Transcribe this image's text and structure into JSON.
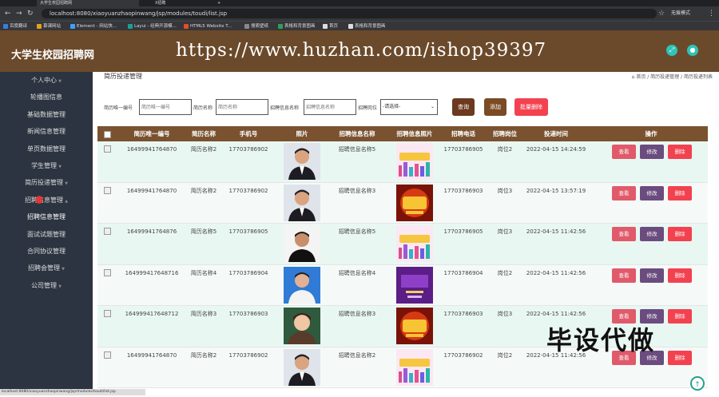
{
  "browser": {
    "tabs": [
      "大学生校园招聘网",
      "X招聘"
    ],
    "url": "localhost:8080/xiaoyuanzhaopinwang/jsp/modules/toudi/list.jsp",
    "profile": "无痕模式",
    "bookmarks": [
      "百度翻译",
      "慕课网站",
      "Element - 网站快...",
      "Layui - 经典开源模...",
      "HTML5 Website T...",
      "搜索壁纸",
      "表格和背景图画",
      "首页",
      "表格和背景图画"
    ],
    "status_url": "localhost:8080/xiaoyuanzhaopinwang/jsp/modules/toudi/list.jsp"
  },
  "header": {
    "brand": "大学生校园招聘网",
    "watermark": "https://www.huzhan.com/ishop39397"
  },
  "sidebar": {
    "items": [
      "个人中心",
      "轮播图信息",
      "基础数据管理",
      "新闻信息管理",
      "单页数据管理",
      "学生管理",
      "简历投递管理",
      "招聘信息管理",
      "招聘信息管理",
      "面试试题管理",
      "合同协议管理",
      "招聘会管理",
      "公司管理"
    ]
  },
  "main": {
    "page_title": "简历投递管理",
    "breadcrumb": "⌂ 首页 / 简历投递管理 / 简历投递列表",
    "search": {
      "label1": "简历唯一编号",
      "placeholder1": "简历唯一编号",
      "label2": "简历名称",
      "placeholder2": "简历名称",
      "label3": "招聘信息名称",
      "placeholder3": "招聘信息名称",
      "label4": "招聘岗位",
      "select_value": "-请选择-",
      "btn_search": "查询",
      "btn_add": "添加",
      "btn_batch_delete": "批量删除"
    },
    "columns": [
      "简历唯一编号",
      "简历名称",
      "手机号",
      "照片",
      "招聘信息名称",
      "招聘信息照片",
      "招聘电话",
      "招聘岗位",
      "投递时间",
      "操作"
    ],
    "row_buttons": {
      "view": "查看",
      "edit": "修改",
      "delete": "删除"
    },
    "rows": [
      {
        "id": "16499941764870",
        "name": "简历名称2",
        "phone": "17703786902",
        "job": "招聘信息名称5",
        "tel": "17703786905",
        "post": "岗位2",
        "time": "2022-04-15 14:24:59",
        "photo": "man-suit",
        "jobimg": "city-banner"
      },
      {
        "id": "16499941764870",
        "name": "简历名称2",
        "phone": "17703786902",
        "job": "招聘信息名称3",
        "tel": "17703786903",
        "post": "岗位3",
        "time": "2022-04-15 13:57:19",
        "photo": "man-suit",
        "jobimg": "gold-banner"
      },
      {
        "id": "16499941764876",
        "name": "简历名称5",
        "phone": "17703786905",
        "job": "招聘信息名称5",
        "tel": "17703786905",
        "post": "岗位3",
        "time": "2022-04-15 11:42:56",
        "photo": "man-shirt",
        "jobimg": "city-banner"
      },
      {
        "id": "16499941764871​6",
        "name": "简历名称4",
        "phone": "17703786904",
        "job": "招聘信息名称4",
        "tel": "17703786904",
        "post": "岗位2",
        "time": "2022-04-15 11:42:56",
        "photo": "man-blue",
        "jobimg": "purple-banner"
      },
      {
        "id": "16499941764871​2",
        "name": "简历名称3",
        "phone": "17703786903",
        "job": "招聘信息名称3",
        "tel": "17703786903",
        "post": "岗位3",
        "time": "2022-04-15 11:42:56",
        "photo": "cartoon",
        "jobimg": "gold-banner"
      },
      {
        "id": "16499941764870",
        "name": "简历名称2",
        "phone": "17703786902",
        "job": "招聘信息名称2",
        "tel": "17703786902",
        "post": "岗位2",
        "time": "2022-04-15 11:42:56",
        "photo": "man-suit",
        "jobimg": "city-banner"
      }
    ]
  },
  "overlay": {
    "stamp": "毕设代做"
  },
  "colors": {
    "header": "#6b4a2b",
    "sidebar": "#2b3440",
    "table_head": "#7a5230",
    "btn_view": "#e05a6a",
    "btn_edit": "#6b4c7f",
    "btn_delete": "#f2424f",
    "btn_search": "#6b3a1f",
    "btn_add": "#7a4b24",
    "btn_batch": "#f2424f"
  }
}
